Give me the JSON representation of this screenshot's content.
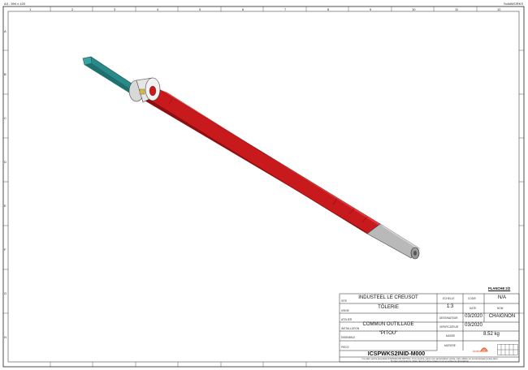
{
  "header": {
    "sheet_format": "A3 - 594 x 420",
    "software": "SolidWORKS"
  },
  "border": {
    "col_marks_top": [
      "1",
      "2",
      "3",
      "4",
      "5",
      "6",
      "7",
      "8",
      "9",
      "10",
      "11",
      "12"
    ],
    "row_marks_left": [
      "A",
      "B",
      "C",
      "D",
      "E",
      "F",
      "G",
      "H"
    ]
  },
  "title_block": {
    "planche": "PLANCHE 2/2",
    "site_caption": "SITE",
    "site": "INDUSTEEL LE CREUSOT",
    "usine_caption": "USINE",
    "usine": "TÔLERIE",
    "atelier_caption": "ATELIER",
    "installation_caption": "INSTALLATION",
    "installation": "COMMUN OUTILLAGE",
    "ensemble_caption": "ENSEMBLE",
    "ensemble": "\"PITOU\"",
    "piece_caption": "PIECE",
    "echelle_caption": "ECHELLE",
    "echelle": "1:3",
    "codif_caption": "CODIF.",
    "codif": "N/A",
    "date_caption": "DATE",
    "nom_caption": "NOM",
    "dessinateur_caption": "DESSINATEUR",
    "dessinateur_date": "03/2020",
    "dessinateur_nom": "CHAIGNON",
    "verificateur_caption": "VERIFICATEUR",
    "verificateur_date": "03/2020",
    "masse_caption": "MASSE",
    "masse": "8.52 kg",
    "matiere_caption": "MATIERE",
    "drawing_number": "ICSPWKS2INID-M000",
    "logo_text": "ArcelorMittal",
    "footer_line1": "Ce plan est la propriété d'ARCELOR MITTAL. Il ne pourra, sans son autorisation écrite, être utilisé ou communiqué à des tiers.",
    "footer_line2": "Toutes précautions utiles devront être prises pour en éviter la divulgation."
  },
  "colors": {
    "shaft": "#c8191c",
    "shaft_dark": "#8e0f11",
    "handle": "#2a8a8a",
    "collar": "#e6e6e6",
    "tip": "#b9b9b9"
  }
}
